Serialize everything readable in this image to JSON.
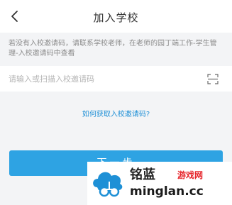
{
  "header": {
    "title": "加入学校"
  },
  "hint": {
    "text": "若没有入校邀请码，请联系学校老师，在老师的园丁端工作-学生管理-入校邀请码中查看"
  },
  "code_input": {
    "placeholder": "请输入或扫描入校邀请码",
    "value": ""
  },
  "help_link": {
    "label": "如何获取入校邀请码?"
  },
  "next_button": {
    "label": "下一步"
  },
  "watermark": {
    "name": "铭蓝",
    "site": "游戏网",
    "url": "minglan.cc"
  },
  "colors": {
    "accent": "#2ea3e3",
    "link": "#1e8fd6",
    "background": "#f3f4f6"
  },
  "icons": {
    "back": "chevron-left-icon",
    "scan": "scan-frame-icon",
    "logo": "cloud-logo-icon"
  }
}
